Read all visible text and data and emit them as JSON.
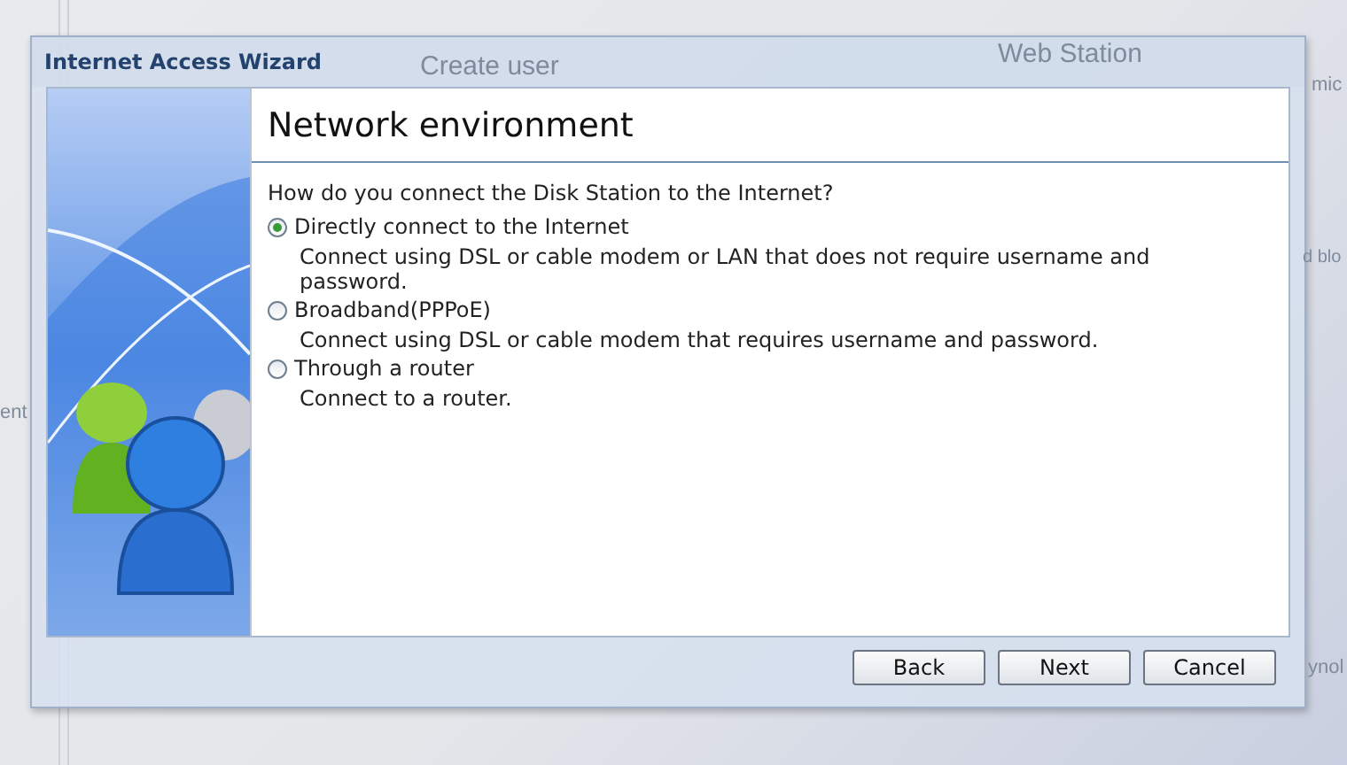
{
  "background": {
    "items": [
      {
        "label": "Create user"
      },
      {
        "label": "Web Station"
      },
      {
        "label": "mic"
      },
      {
        "label": "d blo"
      },
      {
        "label": "ent"
      },
      {
        "label": "ynol"
      }
    ]
  },
  "window": {
    "title": "Internet Access Wizard"
  },
  "page": {
    "heading": "Network environment",
    "question": "How do you connect the Disk Station to the Internet?"
  },
  "options": [
    {
      "label": "Directly connect to the Internet",
      "description": "Connect using DSL or cable modem or LAN that does not require username and password.",
      "selected": true
    },
    {
      "label": "Broadband(PPPoE)",
      "description": "Connect using DSL or cable modem that requires username and password.",
      "selected": false
    },
    {
      "label": "Through a router",
      "description": "Connect to a router.",
      "selected": false
    }
  ],
  "buttons": [
    "Back",
    "Next",
    "Cancel"
  ]
}
